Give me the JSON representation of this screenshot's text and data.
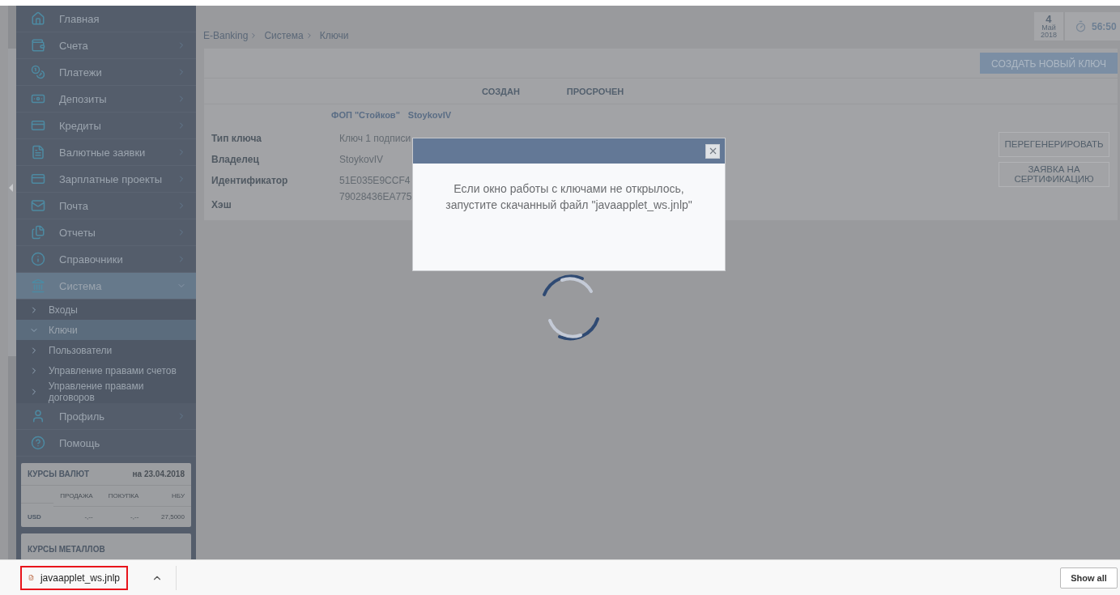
{
  "sidebar": {
    "items": [
      {
        "label": "Главная",
        "kind": "link",
        "selected": false
      },
      {
        "label": "Счета",
        "kind": "submenu",
        "expanded": false,
        "selected": false
      },
      {
        "label": "Платежи",
        "kind": "submenu",
        "expanded": false,
        "selected": false
      },
      {
        "label": "Депозиты",
        "kind": "submenu",
        "expanded": false,
        "selected": false
      },
      {
        "label": "Кредиты",
        "kind": "submenu",
        "expanded": false,
        "selected": false
      },
      {
        "label": "Валютные заявки",
        "kind": "submenu",
        "expanded": false,
        "selected": false
      },
      {
        "label": "Зарплатные проекты",
        "kind": "submenu",
        "expanded": false,
        "selected": false
      },
      {
        "label": "Почта",
        "kind": "submenu",
        "expanded": false,
        "selected": false
      },
      {
        "label": "Отчеты",
        "kind": "submenu",
        "expanded": false,
        "selected": false
      },
      {
        "label": "Справочники",
        "kind": "submenu",
        "expanded": false,
        "selected": false
      },
      {
        "label": "Система",
        "kind": "submenu",
        "expanded": true,
        "selected": true,
        "children": [
          {
            "label": "Входы",
            "selected": false
          },
          {
            "label": "Ключи",
            "selected": true
          },
          {
            "label": "Пользователи",
            "selected": false
          },
          {
            "label": "Управление правами счетов",
            "selected": false
          },
          {
            "label": "Управление правами договоров",
            "selected": false
          }
        ]
      },
      {
        "label": "Профиль",
        "kind": "submenu",
        "expanded": false,
        "selected": false
      },
      {
        "label": "Помощь",
        "kind": "link",
        "selected": false
      }
    ]
  },
  "rates": {
    "title": "КУРСЫ ВАЛЮТ",
    "date": "на 23.04.2018",
    "columns": [
      "ПРОДАЖА",
      "ПОКУПКА",
      "НБУ"
    ],
    "rows": [
      {
        "currency": "USD",
        "values": [
          "-,--",
          "-,--",
          "27,5000"
        ]
      }
    ]
  },
  "metals": {
    "title": "КУРСЫ МЕТАЛЛОВ"
  },
  "breadcrumb": [
    "E-Banking",
    "Система",
    "Ключи"
  ],
  "date_widget": {
    "day": "4",
    "month": "Май",
    "year": "2018",
    "timer": "56:50"
  },
  "toolbar": {
    "create_button": "СОЗДАТЬ НОВЫЙ КЛЮЧ"
  },
  "table": {
    "columns": [
      "СОЗДАН",
      "ПРОСРОЧЕН"
    ]
  },
  "key": {
    "org": "ФОП \"Стойков\"",
    "user": "StoykovIV",
    "fields": [
      {
        "label": "Тип ключа",
        "value": "Ключ 1 подписи"
      },
      {
        "label": "Владелец",
        "value": "StoykovIV"
      },
      {
        "label": "Идентификатор",
        "value": "51E035E9CCF4"
      },
      {
        "label": "Хэш",
        "value": "79028436EA775"
      }
    ],
    "actions": [
      "ПЕРЕГЕНЕРИРОВАТЬ",
      "ЗАЯВКА НА СЕРТИФИКАЦИЮ"
    ]
  },
  "modal": {
    "message": "Если окно работы с ключами не открылось, запустите скачанный файл \"javaapplet_ws.jnlp\""
  },
  "download_bar": {
    "file": "javaapplet_ws.jnlp",
    "show_all": "Show all"
  }
}
